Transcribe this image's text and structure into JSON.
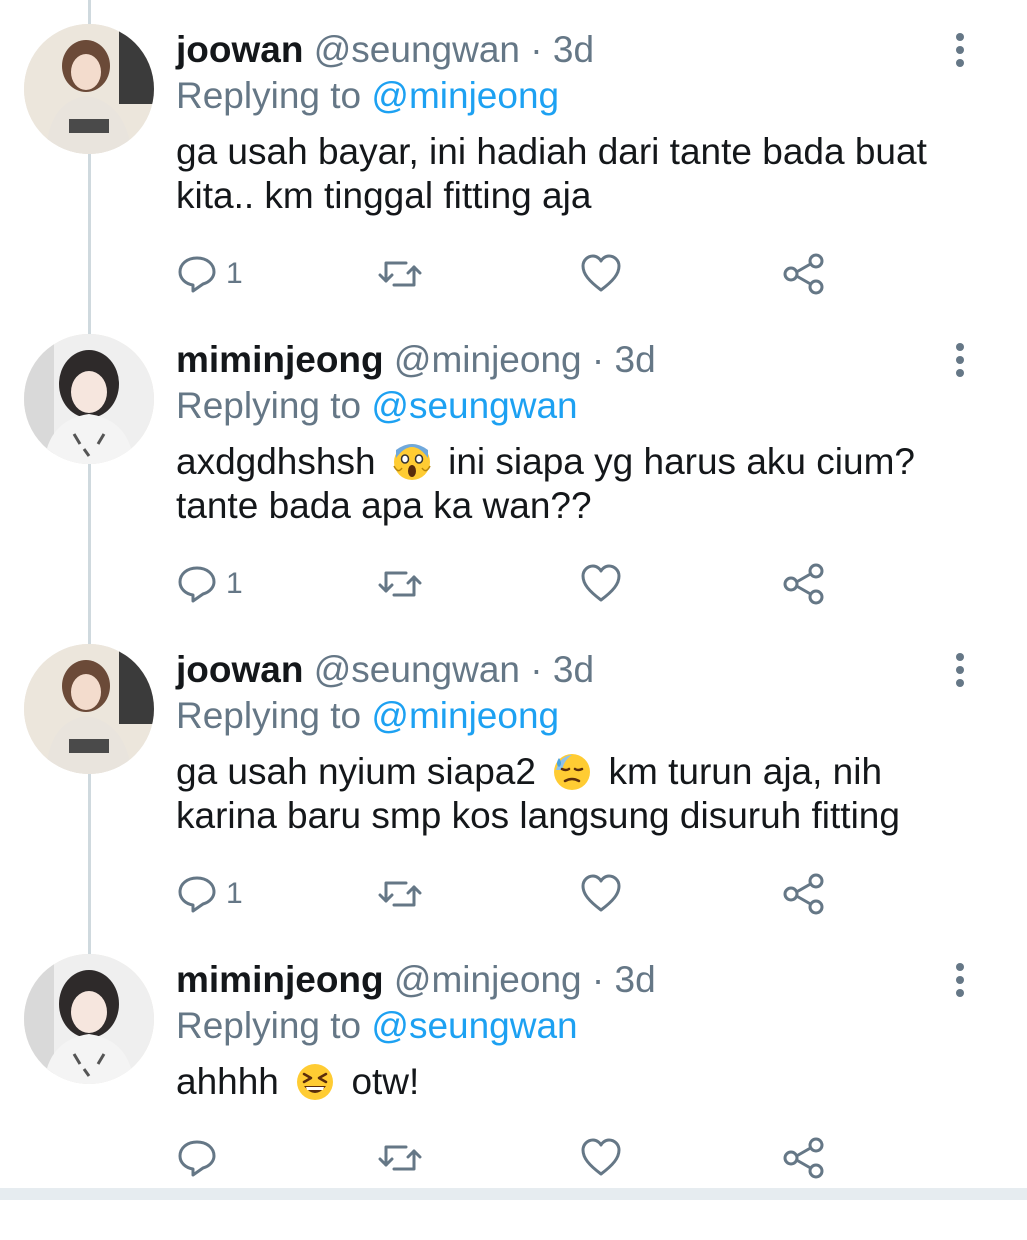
{
  "colors": {
    "name": "#14171a",
    "secondary": "#657786",
    "mention": "#1da1f2",
    "thread_line": "#cfd9de"
  },
  "tweets": [
    {
      "name": "joowan",
      "handle": "@seungwan",
      "separator": "·",
      "time": "3d",
      "replying_prefix": "Replying to",
      "replying_to": "@minjeong",
      "lines": [
        {
          "before": "ga usah bayar, ini hadiah dari tante bada buat",
          "emoji": "",
          "after": ""
        },
        {
          "before": "kita.. km tinggal fitting aja",
          "emoji": "",
          "after": ""
        }
      ],
      "reply_count": "1",
      "avatar_icon": "avatar-joowan"
    },
    {
      "name": "miminjeong",
      "handle": "@minjeong",
      "separator": "·",
      "time": "3d",
      "replying_prefix": "Replying to",
      "replying_to": "@seungwan",
      "lines": [
        {
          "before": "axdgdhshsh",
          "emoji": "scream-emoji",
          "after": "ini siapa yg harus aku cium?"
        },
        {
          "before": "tante bada apa ka wan??",
          "emoji": "",
          "after": ""
        }
      ],
      "reply_count": "1",
      "avatar_icon": "avatar-miminjeong"
    },
    {
      "name": "joowan",
      "handle": "@seungwan",
      "separator": "·",
      "time": "3d",
      "replying_prefix": "Replying to",
      "replying_to": "@minjeong",
      "lines": [
        {
          "before": "ga usah nyium siapa2",
          "emoji": "sweat-emoji",
          "after": "km turun aja, nih"
        },
        {
          "before": "karina baru smp kos langsung disuruh fitting",
          "emoji": "",
          "after": ""
        }
      ],
      "reply_count": "1",
      "avatar_icon": "avatar-joowan"
    },
    {
      "name": "miminjeong",
      "handle": "@minjeong",
      "separator": "·",
      "time": "3d",
      "replying_prefix": "Replying to",
      "replying_to": "@seungwan",
      "lines": [
        {
          "before": "ahhhh",
          "emoji": "laughing-emoji",
          "after": "otw!"
        }
      ],
      "reply_count": "",
      "avatar_icon": "avatar-miminjeong"
    }
  ]
}
